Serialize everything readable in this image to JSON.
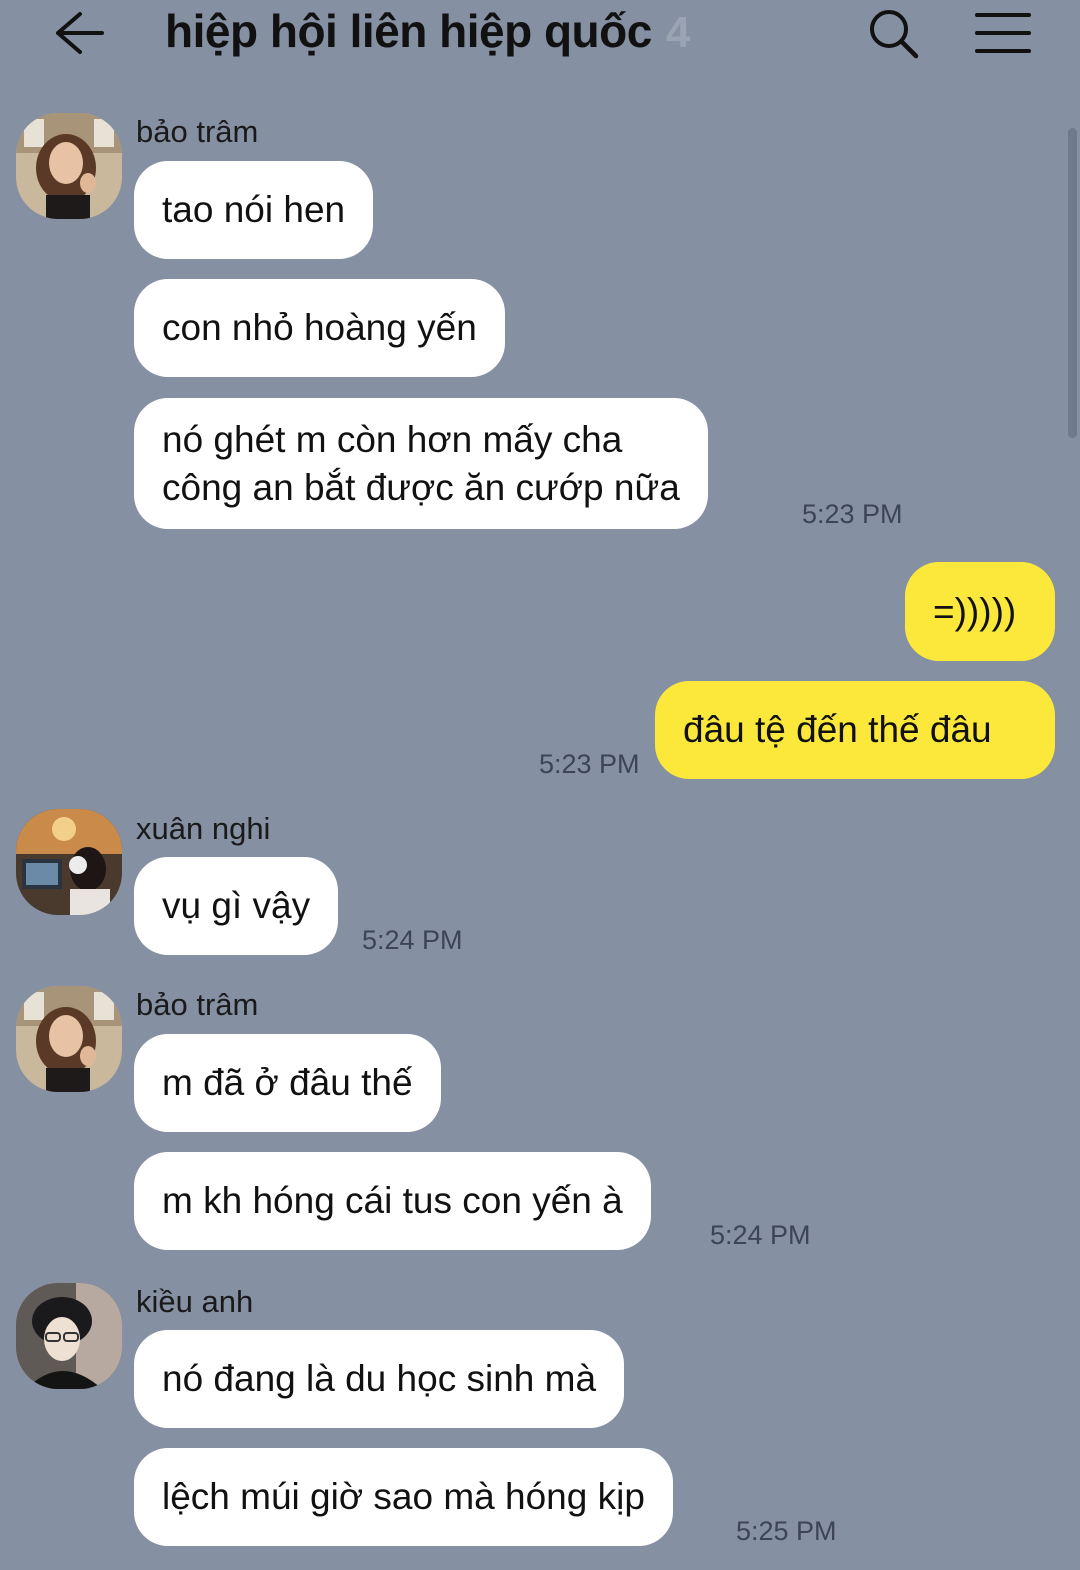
{
  "header": {
    "title": "hiệp hội liên hiệp quốc",
    "member_count": "4",
    "icons": {
      "back": "arrow-left-icon",
      "search": "search-icon",
      "menu": "hamburger-menu-icon"
    }
  },
  "colors": {
    "background": "#8590a3",
    "incoming_bubble": "#ffffff",
    "outgoing_bubble": "#fbe83b"
  },
  "messages": [
    {
      "sender": "bảo trâm",
      "text": "tao nói hen"
    },
    {
      "text": "con nhỏ hoàng yến"
    },
    {
      "text": "nó ghét m còn hơn mấy cha\ncông an bắt được ăn cướp nữa",
      "time": "5:23 PM"
    },
    {
      "own": true,
      "text": "=)))))"
    },
    {
      "own": true,
      "text": "đâu tệ đến thế đâu",
      "time": "5:23 PM"
    },
    {
      "sender": "xuân nghi",
      "text": "vụ gì vậy",
      "time": "5:24 PM"
    },
    {
      "sender": "bảo trâm",
      "text": "m đã ở đâu thế"
    },
    {
      "text": "m kh hóng cái tus con yến à",
      "time": "5:24 PM"
    },
    {
      "sender": "kiều anh",
      "text": "nó đang là du học sinh mà"
    },
    {
      "text": "lệch múi giờ sao mà hóng kịp",
      "time": "5:25 PM"
    }
  ]
}
